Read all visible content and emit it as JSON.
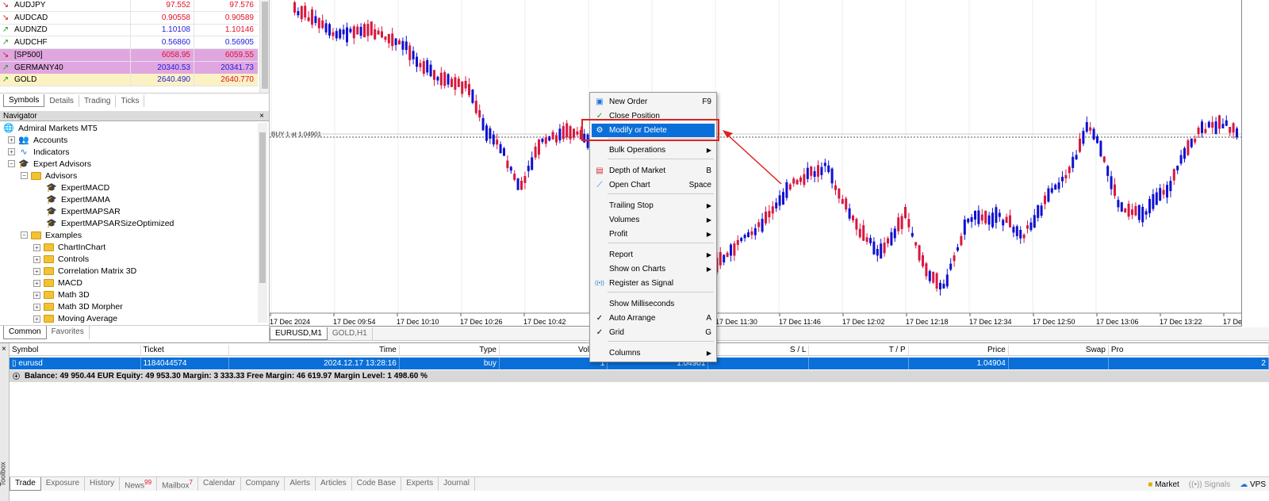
{
  "market_watch": {
    "rows": [
      {
        "arrow": "↘",
        "dir": "down",
        "symbol": "AUDJPY",
        "bid": "97.552",
        "ask": "97.576",
        "bid_color": "red",
        "ask_color": "red",
        "bg": ""
      },
      {
        "arrow": "↘",
        "dir": "down",
        "symbol": "AUDCAD",
        "bid": "0.90558",
        "ask": "0.90589",
        "bid_color": "red",
        "ask_color": "red",
        "bg": ""
      },
      {
        "arrow": "↗",
        "dir": "up",
        "symbol": "AUDNZD",
        "bid": "1.10108",
        "ask": "1.10146",
        "bid_color": "blue",
        "ask_color": "red",
        "bg": ""
      },
      {
        "arrow": "↗",
        "dir": "up",
        "symbol": "AUDCHF",
        "bid": "0.56860",
        "ask": "0.56905",
        "bid_color": "blue",
        "ask_color": "blue",
        "bg": ""
      },
      {
        "arrow": "↘",
        "dir": "down",
        "symbol": "[SP500]",
        "bid": "6058.95",
        "ask": "6059.55",
        "bid_color": "red",
        "ask_color": "red",
        "bg": "#e0a6e0"
      },
      {
        "arrow": "↗",
        "dir": "up",
        "symbol": "GERMANY40",
        "bid": "20340.53",
        "ask": "20341.73",
        "bid_color": "blue",
        "ask_color": "blue",
        "bg": "#e0a6e0"
      },
      {
        "arrow": "↗",
        "dir": "up",
        "symbol": "GOLD",
        "bid": "2640.490",
        "ask": "2640.770",
        "bid_color": "blue",
        "ask_color": "red",
        "bg": "#fbf2c4"
      }
    ],
    "tabs": [
      "Symbols",
      "Details",
      "Trading",
      "Ticks"
    ]
  },
  "navigator": {
    "title": "Navigator",
    "close": "×",
    "items": [
      {
        "label": "Admiral Markets MT5",
        "icon": "globe",
        "exp": ""
      },
      {
        "label": "Accounts",
        "icon": "people",
        "exp": "+"
      },
      {
        "label": "Indicators",
        "icon": "chart",
        "exp": "+"
      },
      {
        "label": "Expert Advisors",
        "icon": "cap",
        "exp": "−"
      },
      {
        "label": "Advisors",
        "icon": "folder",
        "exp": "−"
      },
      {
        "label": "ExpertMACD",
        "icon": "cap",
        "exp": ""
      },
      {
        "label": "ExpertMAMA",
        "icon": "cap",
        "exp": ""
      },
      {
        "label": "ExpertMAPSAR",
        "icon": "cap",
        "exp": ""
      },
      {
        "label": "ExpertMAPSARSizeOptimized",
        "icon": "cap",
        "exp": ""
      },
      {
        "label": "Examples",
        "icon": "folder",
        "exp": "−"
      },
      {
        "label": "ChartInChart",
        "icon": "folder",
        "exp": "+"
      },
      {
        "label": "Controls",
        "icon": "folder",
        "exp": "+"
      },
      {
        "label": "Correlation Matrix 3D",
        "icon": "folder",
        "exp": "+"
      },
      {
        "label": "MACD",
        "icon": "folder",
        "exp": "+"
      },
      {
        "label": "Math 3D",
        "icon": "folder",
        "exp": "+"
      },
      {
        "label": "Math 3D Morpher",
        "icon": "folder",
        "exp": "+"
      },
      {
        "label": "Moving Average",
        "icon": "folder",
        "exp": "+"
      }
    ],
    "tabs": [
      "Common",
      "Favorites"
    ]
  },
  "chart": {
    "order_line_label": "BUY 1 at 1.04901",
    "time_labels": [
      "17 Dec 2024",
      "17 Dec 09:54",
      "17 Dec 10:10",
      "17 Dec 10:26",
      "17 Dec 10:42",
      "17 Dec 11:30",
      "17 Dec 11:46",
      "17 Dec 12:02",
      "17 Dec 12:18",
      "17 Dec 12:34",
      "17 Dec 12:50",
      "17 Dec 13:06",
      "17 Dec 13:22",
      "17 Dec"
    ],
    "tabs": [
      "EURUSD,M1",
      "GOLD,H1"
    ],
    "up_color": "#1010d0",
    "down_color": "#d81840"
  },
  "context_menu": {
    "items": [
      {
        "label": "New Order",
        "shortcut": "F9",
        "icon": "new-order-icon",
        "glyph": "▣",
        "submenu": false,
        "highlight": false
      },
      {
        "label": "Close Position",
        "shortcut": "",
        "icon": "check-icon",
        "glyph": "✓",
        "submenu": false,
        "highlight": false
      },
      {
        "label": "Modify or Delete",
        "shortcut": "",
        "icon": "gear-icon",
        "glyph": "⚙",
        "submenu": false,
        "highlight": true
      },
      {
        "label": "Bulk Operations",
        "shortcut": "",
        "icon": "",
        "glyph": "",
        "submenu": true,
        "highlight": false
      },
      {
        "label": "Depth of Market",
        "shortcut": "B",
        "icon": "depth-icon",
        "glyph": "▤",
        "submenu": false,
        "highlight": false
      },
      {
        "label": "Open Chart",
        "shortcut": "Space",
        "icon": "chart-icon",
        "glyph": "⟋",
        "submenu": false,
        "highlight": false
      },
      {
        "label": "Trailing Stop",
        "shortcut": "",
        "icon": "",
        "glyph": "",
        "submenu": true,
        "highlight": false
      },
      {
        "label": "Volumes",
        "shortcut": "",
        "icon": "",
        "glyph": "",
        "submenu": true,
        "highlight": false
      },
      {
        "label": "Profit",
        "shortcut": "",
        "icon": "",
        "glyph": "",
        "submenu": true,
        "highlight": false
      },
      {
        "label": "Report",
        "shortcut": "",
        "icon": "",
        "glyph": "",
        "submenu": true,
        "highlight": false
      },
      {
        "label": "Show on Charts",
        "shortcut": "",
        "icon": "",
        "glyph": "",
        "submenu": true,
        "highlight": false
      },
      {
        "label": "Register as Signal",
        "shortcut": "",
        "icon": "signal-icon",
        "glyph": "((•))",
        "submenu": false,
        "highlight": false
      },
      {
        "label": "Show Milliseconds",
        "shortcut": "",
        "icon": "",
        "glyph": "",
        "submenu": false,
        "highlight": false
      },
      {
        "label": "Auto Arrange",
        "shortcut": "A",
        "icon": "check-icon",
        "glyph": "✓",
        "submenu": false,
        "highlight": false
      },
      {
        "label": "Grid",
        "shortcut": "G",
        "icon": "check-icon",
        "glyph": "✓",
        "submenu": false,
        "highlight": false
      },
      {
        "label": "Columns",
        "shortcut": "",
        "icon": "",
        "glyph": "",
        "submenu": true,
        "highlight": false
      }
    ]
  },
  "toolbox": {
    "title": "Toolbox",
    "close": "×",
    "columns": [
      "Symbol",
      "Ticket",
      "Time",
      "Type",
      "Volume",
      "",
      "S / L",
      "T / P",
      "Price",
      "Swap",
      "Pro"
    ],
    "row": [
      "eurusd",
      "1184044574",
      "2024.12.17 13:28:16",
      "buy",
      "1",
      "1.04901",
      "",
      "",
      "1.04904",
      "",
      "2"
    ],
    "balance": "Balance: 49 950.44 EUR  Equity: 49 953.30  Margin: 3 333.33  Free Margin: 46 619.97  Margin Level: 1 498.60 %",
    "tabs": [
      {
        "label": "Trade",
        "badge": ""
      },
      {
        "label": "Exposure",
        "badge": ""
      },
      {
        "label": "History",
        "badge": ""
      },
      {
        "label": "News",
        "badge": "99"
      },
      {
        "label": "Mailbox",
        "badge": "7"
      },
      {
        "label": "Calendar",
        "badge": ""
      },
      {
        "label": "Company",
        "badge": ""
      },
      {
        "label": "Alerts",
        "badge": ""
      },
      {
        "label": "Articles",
        "badge": ""
      },
      {
        "label": "Code Base",
        "badge": ""
      },
      {
        "label": "Experts",
        "badge": ""
      },
      {
        "label": "Journal",
        "badge": ""
      }
    ],
    "status": {
      "market": "Market",
      "signals": "Signals",
      "vps": "VPS"
    }
  },
  "annotation": {
    "color": "#e02020"
  }
}
